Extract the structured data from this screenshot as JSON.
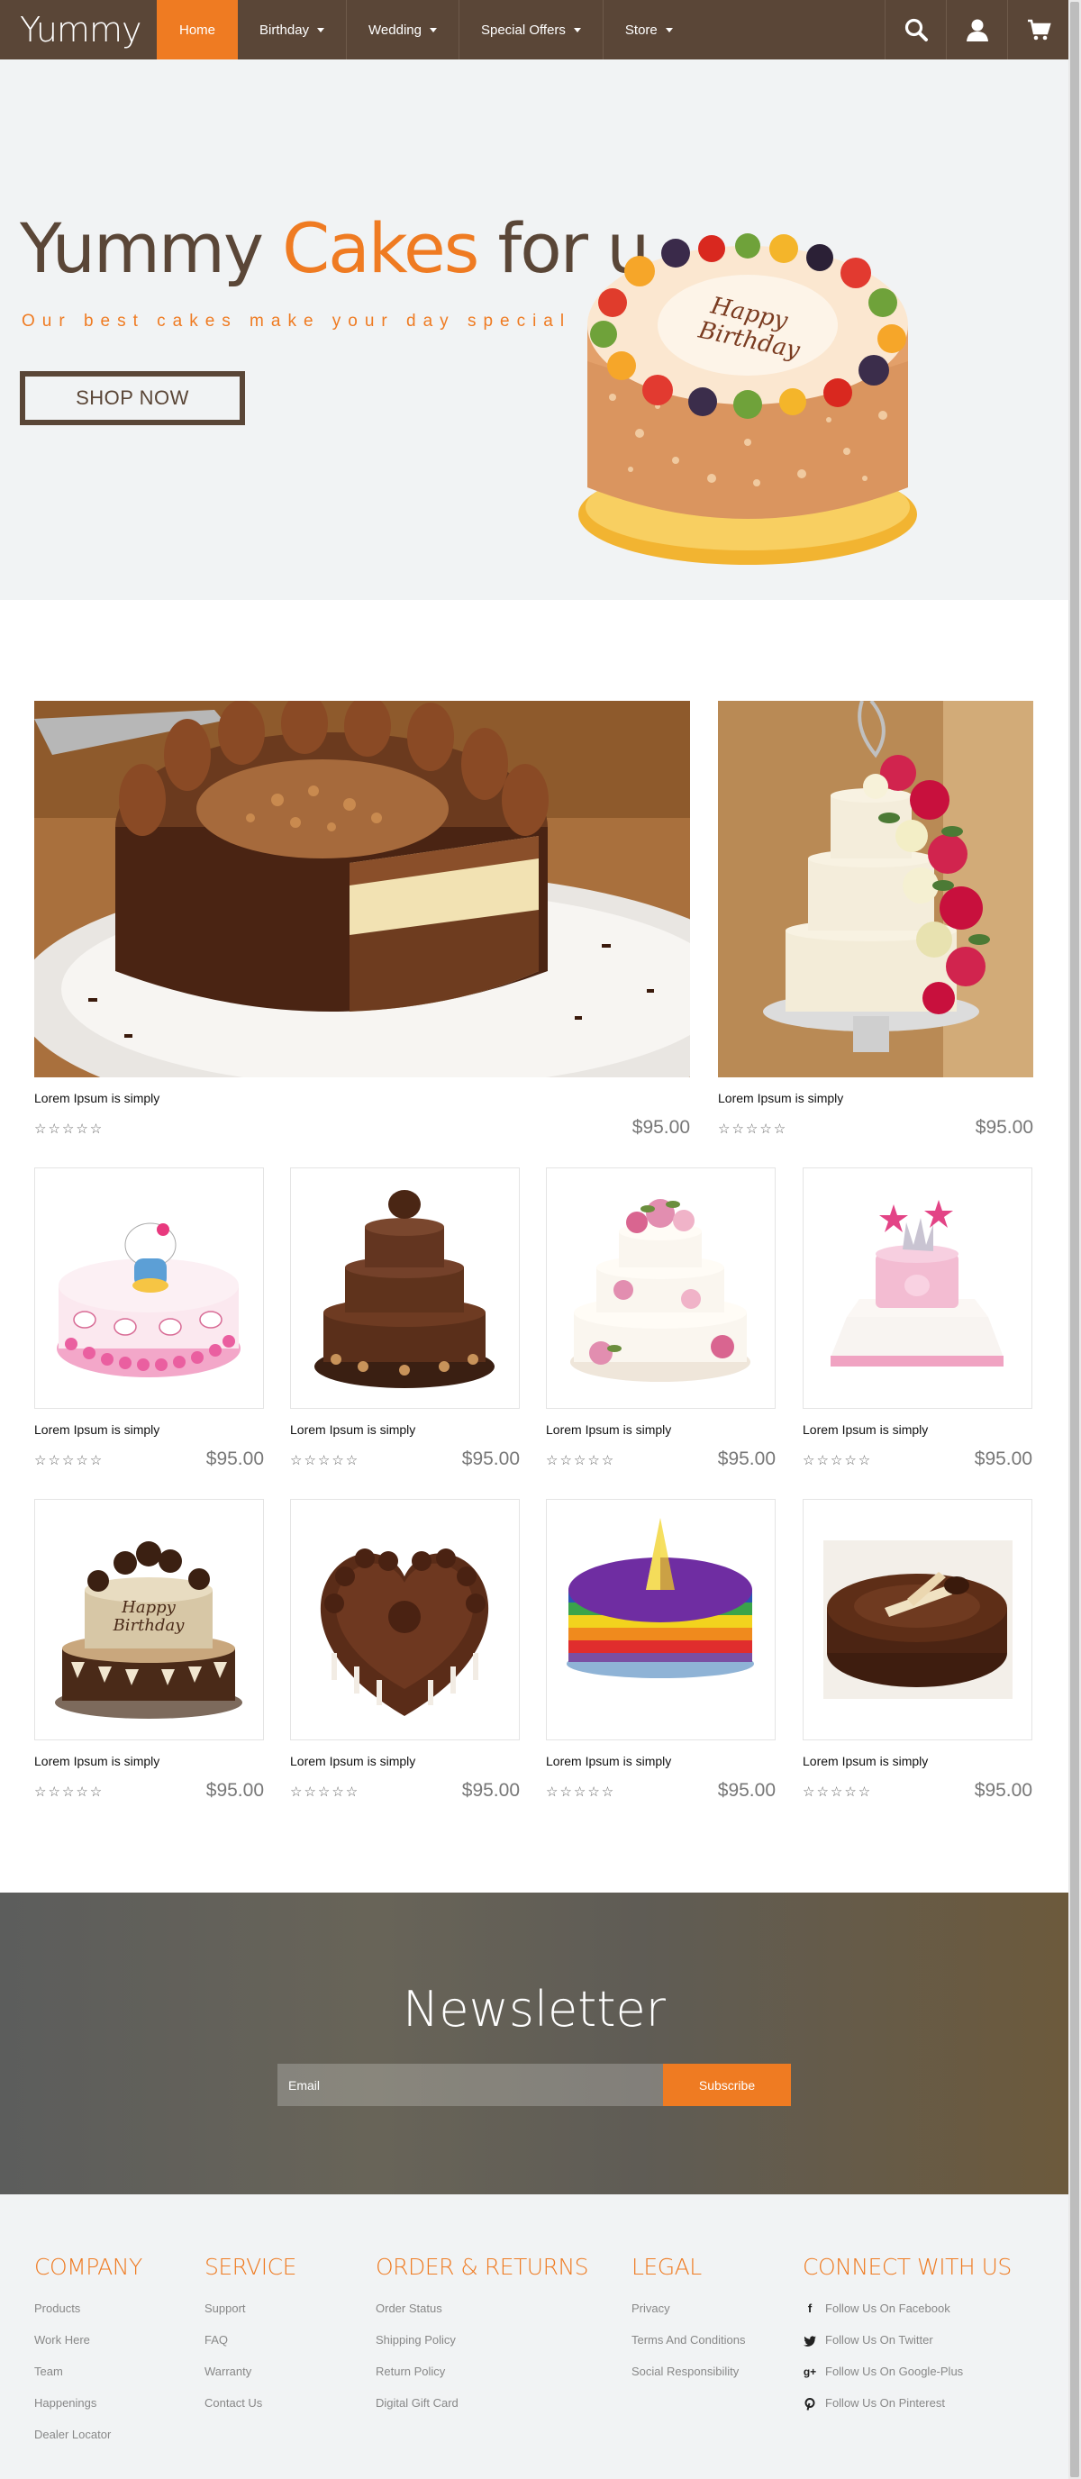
{
  "nav": {
    "logo": "Yummy",
    "items": [
      {
        "label": "Home",
        "active": true,
        "dropdown": false
      },
      {
        "label": "Birthday",
        "active": false,
        "dropdown": true
      },
      {
        "label": "Wedding",
        "active": false,
        "dropdown": true
      },
      {
        "label": "Special Offers",
        "active": false,
        "dropdown": true
      },
      {
        "label": "Store",
        "active": false,
        "dropdown": true
      }
    ],
    "icons": [
      "search-icon",
      "user-icon",
      "cart-icon"
    ]
  },
  "hero": {
    "title_part1": "Yummy ",
    "title_accent": "Cakes",
    "title_part2": " for u",
    "subtitle": "Our best cakes make your day special",
    "cta": "SHOP NOW",
    "cake_text": "Happy Birthday"
  },
  "products": [
    {
      "name": "Lorem Ipsum is simply",
      "price": "$95.00",
      "rating": 0,
      "image": "chocolate-cake"
    },
    {
      "name": "Lorem Ipsum is simply",
      "price": "$95.00",
      "rating": 0,
      "image": "floral-wedding-cake"
    },
    {
      "name": "Lorem Ipsum is simply",
      "price": "$95.00",
      "rating": 0,
      "image": "hello-kitty-cake"
    },
    {
      "name": "Lorem Ipsum is simply",
      "price": "$95.00",
      "rating": 0,
      "image": "tiered-chocolate-cake"
    },
    {
      "name": "Lorem Ipsum is simply",
      "price": "$95.00",
      "rating": 0,
      "image": "white-floral-cake"
    },
    {
      "name": "Lorem Ipsum is simply",
      "price": "$95.00",
      "rating": 0,
      "image": "pink-crown-cake"
    },
    {
      "name": "Lorem Ipsum is simply",
      "price": "$95.00",
      "rating": 0,
      "image": "birthday-chocolate-cake"
    },
    {
      "name": "Lorem Ipsum is simply",
      "price": "$95.00",
      "rating": 0,
      "image": "heart-rose-cake"
    },
    {
      "name": "Lorem Ipsum is simply",
      "price": "$95.00",
      "rating": 0,
      "image": "rainbow-cake"
    },
    {
      "name": "Lorem Ipsum is simply",
      "price": "$95.00",
      "rating": 0,
      "image": "chocolate-swirl-cake"
    }
  ],
  "stars_text": "☆☆☆☆☆",
  "newsletter": {
    "title": "Newsletter",
    "placeholder": "Email",
    "button": "Subscribe"
  },
  "footer": {
    "columns": [
      {
        "title": "COMPANY",
        "links": [
          "Products",
          "Work Here",
          "Team",
          "Happenings",
          "Dealer Locator"
        ]
      },
      {
        "title": "SERVICE",
        "links": [
          "Support",
          "FAQ",
          "Warranty",
          "Contact Us"
        ]
      },
      {
        "title": "ORDER & RETURNS",
        "links": [
          "Order Status",
          "Shipping Policy",
          "Return Policy",
          "Digital Gift Card"
        ]
      },
      {
        "title": "LEGAL",
        "links": [
          "Privacy",
          "Terms And Conditions",
          "Social Responsibility"
        ]
      },
      {
        "title": "CONNECT WITH US",
        "links": [
          "Follow Us On Facebook",
          "Follow Us On Twitter",
          "Follow Us On Google-Plus",
          "Follow Us On Pinterest"
        ],
        "icons": [
          "facebook-icon",
          "twitter-icon",
          "google-plus-icon",
          "pinterest-icon"
        ]
      }
    ]
  },
  "colors": {
    "brown": "#5a4637",
    "orange": "#ef7b22",
    "light_bg": "#f1f3f4"
  }
}
